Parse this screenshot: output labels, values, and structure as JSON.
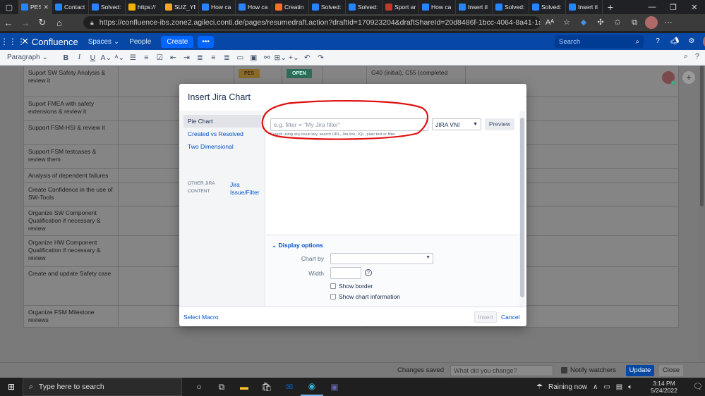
{
  "browser": {
    "tabs": [
      {
        "title": "PES",
        "icon": "confluence-icon",
        "color": "#2684ff",
        "active": true
      },
      {
        "title": "Contact",
        "icon": "confluence-icon",
        "color": "#2684ff"
      },
      {
        "title": "Solved:",
        "icon": "atlassian-icon",
        "color": "#2684ff"
      },
      {
        "title": "https://",
        "icon": "world-icon",
        "color": "#f0b400"
      },
      {
        "title": "SUZ_YE",
        "icon": "doc-icon",
        "color": "#f5a623"
      },
      {
        "title": "How ca",
        "icon": "atlassian-icon",
        "color": "#2684ff"
      },
      {
        "title": "How ca",
        "icon": "atlassian-icon",
        "color": "#2684ff"
      },
      {
        "title": "Creatin",
        "icon": "gitlab-icon",
        "color": "#fc6d26"
      },
      {
        "title": "Solved:",
        "icon": "atlassian-icon",
        "color": "#2684ff"
      },
      {
        "title": "Solved:",
        "icon": "atlassian-icon",
        "color": "#2684ff"
      },
      {
        "title": "Sport ar",
        "icon": "sport-icon",
        "color": "#c0392b"
      },
      {
        "title": "How ca",
        "icon": "atlassian-icon",
        "color": "#2684ff"
      },
      {
        "title": "Insert tl",
        "icon": "atlassian-icon",
        "color": "#2684ff"
      },
      {
        "title": "Solved:",
        "icon": "atlassian-icon",
        "color": "#2684ff"
      },
      {
        "title": "Solved:",
        "icon": "atlassian-icon",
        "color": "#2684ff"
      },
      {
        "title": "Insert tl",
        "icon": "atlassian-icon",
        "color": "#2684ff"
      }
    ],
    "url": "https://confluence-ibs.zone2.agileci.conti.de/pages/resumedraft.action?draftId=170923204&draftShareId=20d8486f-1bcc-4064-8a41-1a9bc516..."
  },
  "confluence": {
    "logo_text": "Confluence",
    "nav_spaces": "Spaces ⌄",
    "nav_people": "People",
    "create_label": "Create",
    "more_label": "•••",
    "search_placeholder": "Search"
  },
  "toolbar": {
    "paragraph_label": "Paragraph ⌄"
  },
  "table": {
    "rows": [
      {
        "task": "Suport SW Safety Analysis & review it",
        "status1": "PES",
        "status2": "OPEN",
        "note": "G40 (initial), C55 (completed"
      },
      {
        "task": "Suport FMEA with safety extensions & review it"
      },
      {
        "task": "Support FSM-HSI & review it"
      },
      {
        "task": "Support FSM testcases & review them"
      },
      {
        "task": "Analysis of dependent failures"
      },
      {
        "task": "Create Confidence in the use of SW-Tools"
      },
      {
        "task": "Organize SW Component Qualification if necessary & review"
      },
      {
        "task": "Organize HW Component Qualification if necessary & review"
      },
      {
        "task": "Create and update Safety case"
      },
      {
        "task": "Organize FSM Milestone reviews"
      }
    ]
  },
  "modal": {
    "title": "Insert Jira Chart",
    "sidebar": [
      {
        "label": "Pie Chart",
        "selected": true
      },
      {
        "label": "Created vs Resolved"
      },
      {
        "label": "Two Dimensional"
      }
    ],
    "other_jira_label": "OTHER JIRA CONTENT",
    "other_jira_link": "Jira Issue/Filter",
    "filter_placeholder": "e.g. filter = \"My Jira filter\"",
    "filter_help": "Search using any issue key, search URL, Jira link, JQL, plain text or filter",
    "server_value": "JIRA VNI",
    "preview_label": "Preview",
    "display_options_label": "Display options",
    "chart_by_label": "Chart by",
    "width_label": "Width",
    "show_border_label": "Show border",
    "show_chart_info_label": "Show chart information",
    "select_macro_label": "Select Macro",
    "insert_label": "Insert",
    "cancel_label": "Cancel"
  },
  "editor_footer": {
    "changes_saved": "Changes saved",
    "change_placeholder": "What did you change?",
    "notify_watchers": "Notify watchers",
    "update_label": "Update",
    "close_label": "Close"
  },
  "taskbar": {
    "search_placeholder": "Type here to search",
    "weather": "Raining now",
    "time": "3:14 PM",
    "date": "5/24/2022"
  },
  "colors": {
    "confluence_blue": "#0747a6",
    "annotation_red": "#e01010",
    "link_blue": "#0052cc"
  }
}
